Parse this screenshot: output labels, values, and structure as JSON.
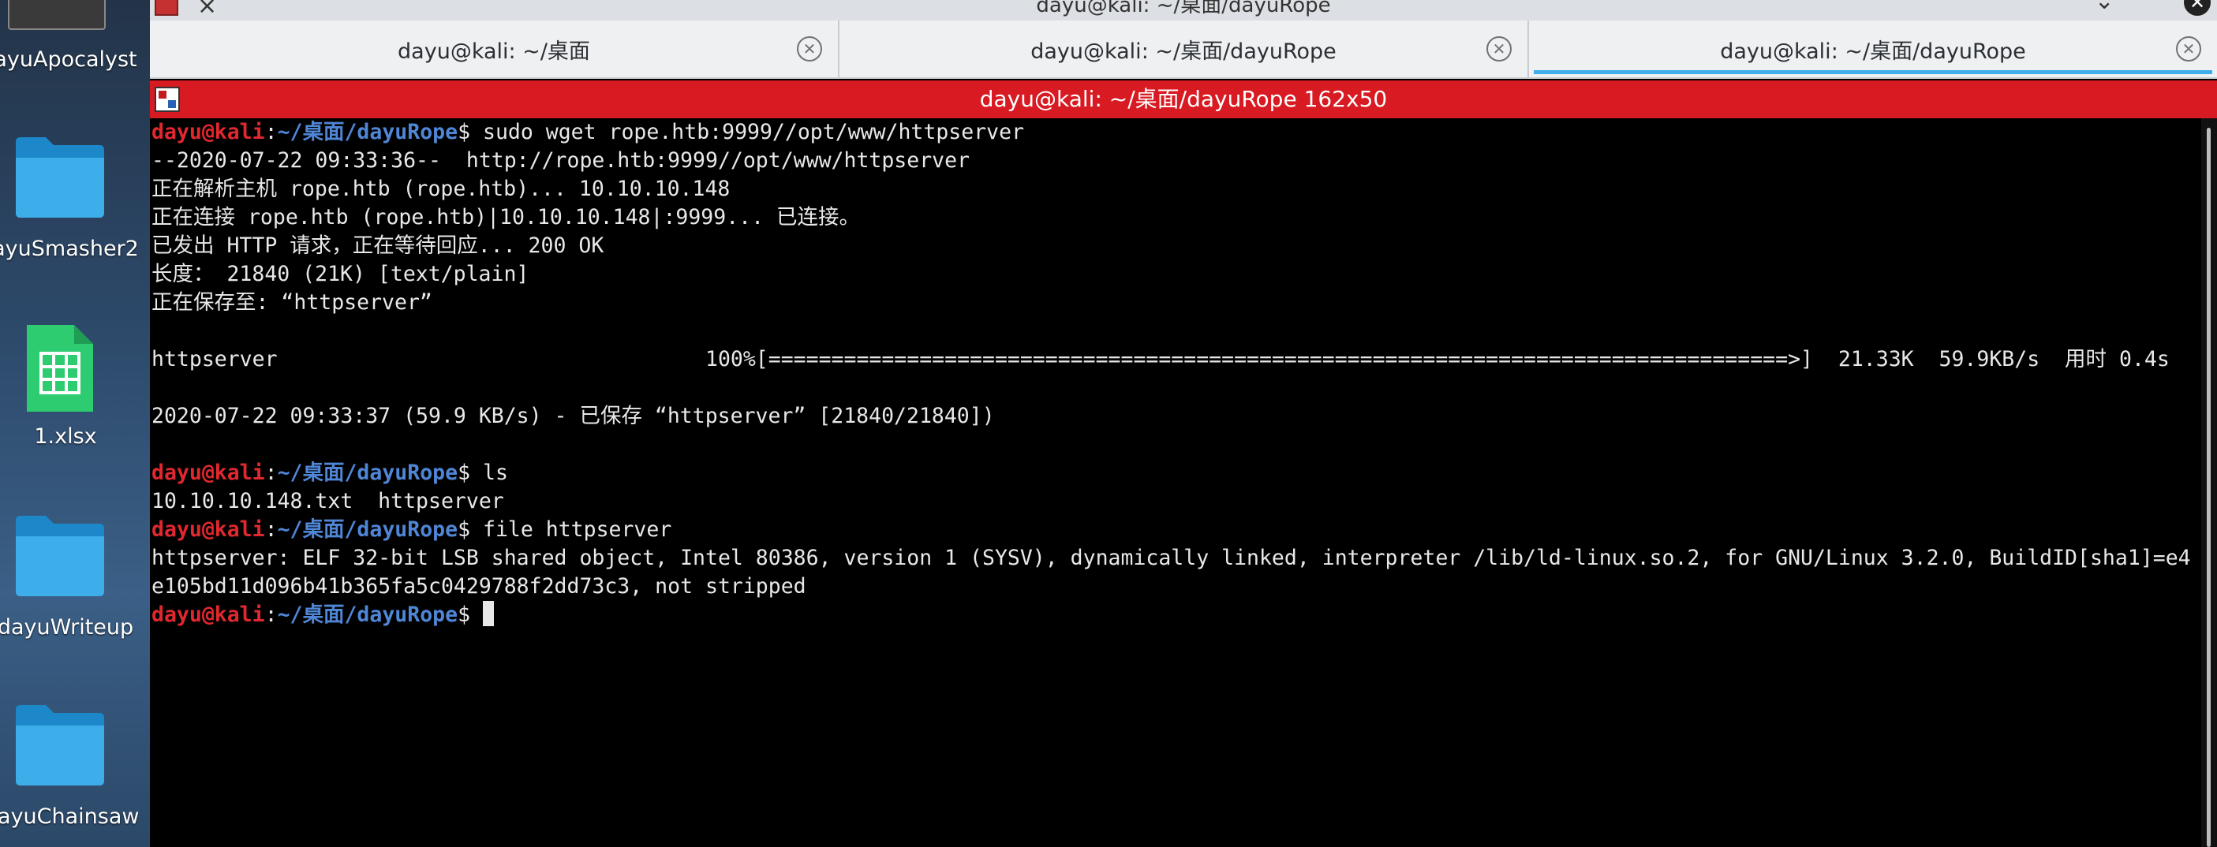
{
  "desktop": {
    "items": [
      {
        "label": "ayuApocalyst"
      },
      {
        "label": "ayuSmasher2"
      },
      {
        "label": "1.xlsx"
      },
      {
        "label": "dayuWriteup"
      },
      {
        "label": "layuChainsaw"
      }
    ]
  },
  "window": {
    "title": "dayu@kali: ~/桌面/dayuRope",
    "close_glyph": "×"
  },
  "tabs": [
    {
      "label": "dayu@kali: ~/桌面",
      "active": false
    },
    {
      "label": "dayu@kali: ~/桌面/dayuRope",
      "active": false
    },
    {
      "label": "dayu@kali: ~/桌面/dayuRope",
      "active": true
    }
  ],
  "terminal_header": {
    "title": "dayu@kali: ~/桌面/dayuRope 162x50"
  },
  "prompt": {
    "user": "dayu@kali",
    "sep": ":",
    "path": "~/桌面/dayuRope",
    "symbol": "$ "
  },
  "terminal": {
    "lines": [
      {
        "type": "prompt",
        "cmd": "sudo wget rope.htb:9999//opt/www/httpserver"
      },
      {
        "type": "out",
        "text": "--2020-07-22 09:33:36--  http://rope.htb:9999//opt/www/httpserver"
      },
      {
        "type": "out",
        "text": "正在解析主机 rope.htb (rope.htb)... 10.10.10.148"
      },
      {
        "type": "out",
        "text": "正在连接 rope.htb (rope.htb)|10.10.10.148|:9999... 已连接。"
      },
      {
        "type": "out",
        "text": "已发出 HTTP 请求，正在等待回应... 200 OK"
      },
      {
        "type": "out",
        "text": "长度： 21840 (21K) [text/plain]"
      },
      {
        "type": "out",
        "text": "正在保存至: “httpserver”"
      },
      {
        "type": "out",
        "text": ""
      },
      {
        "type": "out",
        "text": "httpserver                                  100%[=================================================================================>]  21.33K  59.9KB/s  用时 0.4s"
      },
      {
        "type": "out",
        "text": ""
      },
      {
        "type": "out",
        "text": "2020-07-22 09:33:37 (59.9 KB/s) - 已保存 “httpserver” [21840/21840])"
      },
      {
        "type": "out",
        "text": ""
      },
      {
        "type": "prompt",
        "cmd": "ls"
      },
      {
        "type": "out",
        "text": "10.10.10.148.txt  httpserver"
      },
      {
        "type": "prompt",
        "cmd": "file httpserver"
      },
      {
        "type": "out",
        "text": "httpserver: ELF 32-bit LSB shared object, Intel 80386, version 1 (SYSV), dynamically linked, interpreter /lib/ld-linux.so.2, for GNU/Linux 3.2.0, BuildID[sha1]=e4"
      },
      {
        "type": "out",
        "text": "e105bd11d096b41b365fa5c0429788f2dd73c3, not stripped"
      },
      {
        "type": "prompt",
        "cmd": "",
        "cursor": true
      }
    ]
  },
  "colors": {
    "prompt_user": "#e0282e",
    "prompt_path": "#4f86d6",
    "header_bg": "#d81a22",
    "active_tab_accent": "#3daee9"
  }
}
